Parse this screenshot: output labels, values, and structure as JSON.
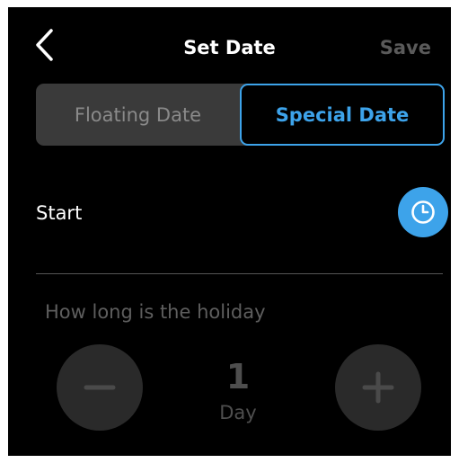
{
  "header": {
    "title": "Set Date",
    "save_label": "Save",
    "back_icon": "chevron-left-icon"
  },
  "tabs": [
    {
      "label": "Floating Date",
      "selected": false
    },
    {
      "label": "Special Date",
      "selected": true
    }
  ],
  "start": {
    "label": "Start",
    "icon": "clock-icon"
  },
  "duration": {
    "label": "How long is the holiday",
    "value": "1",
    "unit": "Day",
    "decrement_icon": "minus-icon",
    "increment_icon": "plus-icon"
  },
  "colors": {
    "accent": "#3da3ea",
    "background": "#000000",
    "disabled": "#4e4e4e"
  }
}
